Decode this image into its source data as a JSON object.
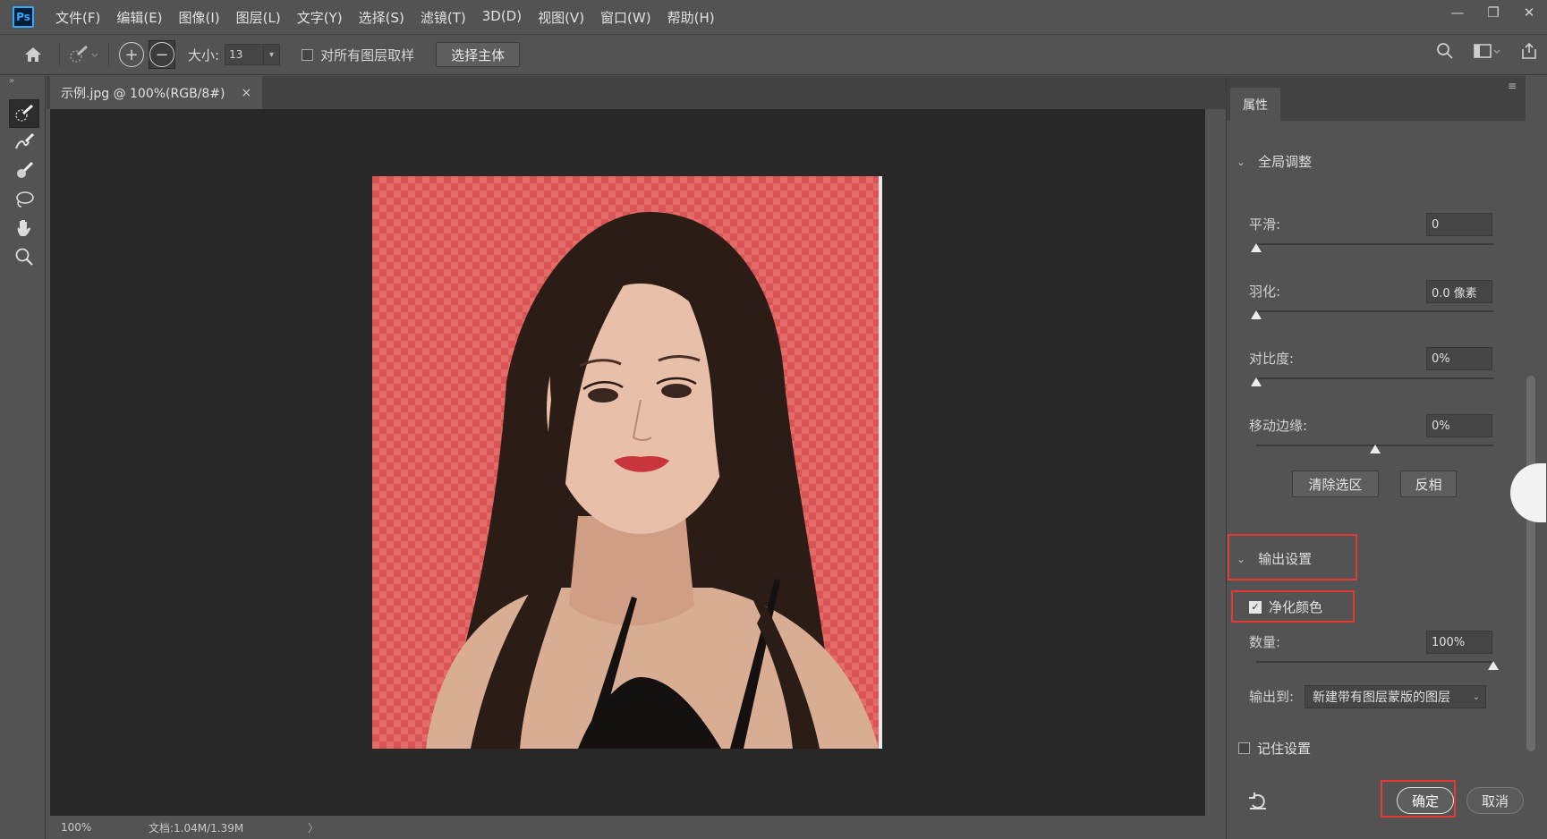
{
  "app": {
    "logo": "Ps"
  },
  "menu": [
    "文件(F)",
    "编辑(E)",
    "图像(I)",
    "图层(L)",
    "文字(Y)",
    "选择(S)",
    "滤镜(T)",
    "3D(D)",
    "视图(V)",
    "窗口(W)",
    "帮助(H)"
  ],
  "window_controls": {
    "minimize": "—",
    "restore": "❐",
    "close": "✕"
  },
  "options": {
    "size_label": "大小:",
    "size_value": "13",
    "sample_all_label": "对所有图层取样",
    "select_subject": "选择主体"
  },
  "document": {
    "tab_title": "示例.jpg @ 100%(RGB/8#)",
    "close": "×",
    "zoom": "100%",
    "doc_info": "文档:1.04M/1.39M",
    "status_arrow": "〉"
  },
  "panel": {
    "tab": "属性",
    "global_adjust": "全局调整",
    "smooth_label": "平滑:",
    "smooth_value": "0",
    "smooth_level": 0,
    "feather_label": "羽化:",
    "feather_value": "0.0 像素",
    "feather_level": 0,
    "contrast_label": "对比度:",
    "contrast_value": "0%",
    "contrast_level": 0,
    "shift_label": "移动边缘:",
    "shift_value": "0%",
    "shift_level": 0.5,
    "clear_selection": "清除选区",
    "invert": "反相",
    "output_settings": "输出设置",
    "decontaminate_label": "净化颜色",
    "decontaminate_checked": true,
    "amount_label": "数量:",
    "amount_value": "100%",
    "amount_level": 1.0,
    "output_to_label": "输出到:",
    "output_to_value": "新建带有图层蒙版的图层",
    "remember_label": "记住设置",
    "ok": "确定",
    "cancel": "取消"
  },
  "colors": {
    "highlight_box": "#e53935",
    "overlay_red": "#e05a5a",
    "ps_blue": "#31a8ff"
  }
}
